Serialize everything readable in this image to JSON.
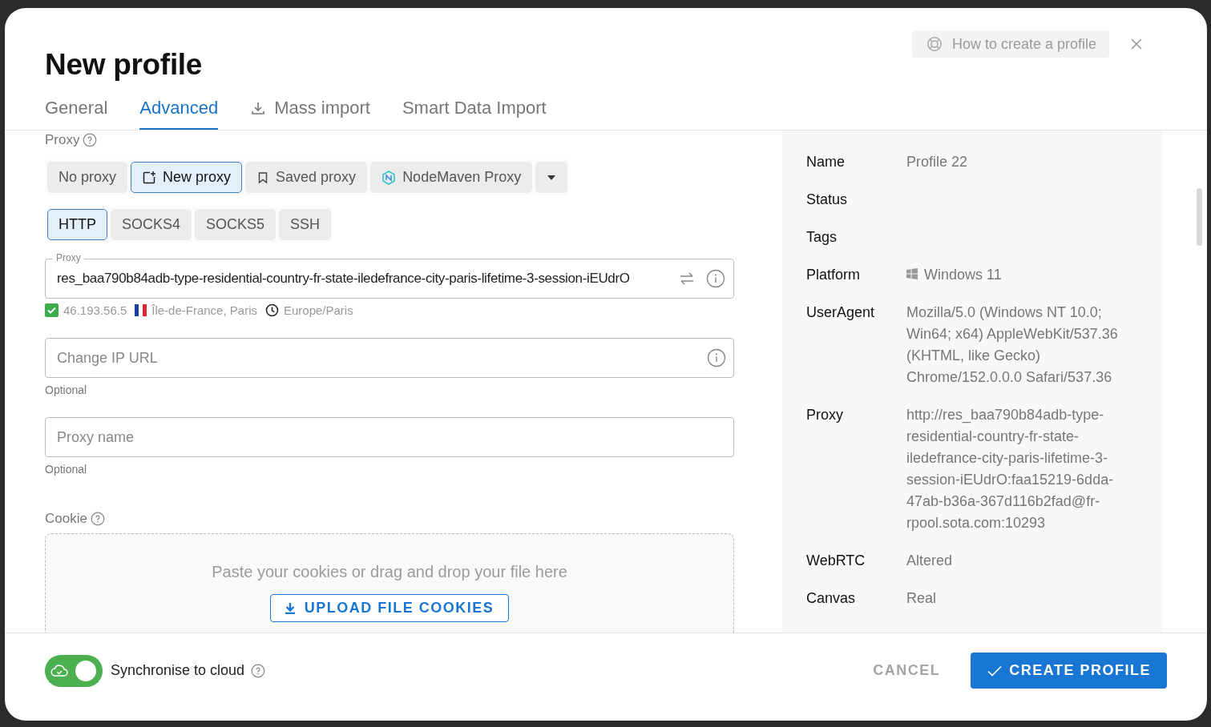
{
  "header": {
    "title": "New profile",
    "help_button": "How to create a profile"
  },
  "tabs": [
    {
      "label": "General",
      "selected": false
    },
    {
      "label": "Advanced",
      "selected": true
    },
    {
      "label": "Mass import",
      "selected": false
    },
    {
      "label": "Smart Data Import",
      "selected": false
    }
  ],
  "proxy_section": {
    "label": "Proxy",
    "sources": [
      {
        "label": "No proxy",
        "selected": false
      },
      {
        "label": "New proxy",
        "selected": true
      },
      {
        "label": "Saved proxy",
        "selected": false
      },
      {
        "label": "NodeMaven Proxy",
        "selected": false
      }
    ],
    "protocols": [
      {
        "label": "HTTP",
        "selected": true
      },
      {
        "label": "SOCKS4",
        "selected": false
      },
      {
        "label": "SOCKS5",
        "selected": false
      },
      {
        "label": "SSH",
        "selected": false
      }
    ],
    "proxy_field": {
      "label": "Proxy",
      "value": "res_baa790b84adb-type-residential-country-fr-state-iledefrance-city-paris-lifetime-3-session-iEUdrO"
    },
    "check": {
      "ok": true,
      "ip": "46.193.56.5",
      "location": "Île-de-France, Paris",
      "timezone": "Europe/Paris"
    },
    "change_ip_field": {
      "placeholder": "Change IP URL",
      "helper": "Optional"
    },
    "name_field": {
      "placeholder": "Proxy name",
      "helper": "Optional"
    }
  },
  "cookie_section": {
    "label": "Cookie",
    "drop_text": "Paste your cookies or drag and drop your file here",
    "upload_button": "UPLOAD FILE COOKIES"
  },
  "summary": [
    {
      "key": "Name",
      "value": "Profile 22"
    },
    {
      "key": "Status"
    },
    {
      "key": "Tags"
    },
    {
      "key": "Platform",
      "value": "Windows 11"
    },
    {
      "key": "UserAgent",
      "value": "Mozilla/5.0 (Windows NT 10.0; Win64; x64) AppleWebKit/537.36 (KHTML, like Gecko) Chrome/152.0.0.0 Safari/537.36"
    },
    {
      "key": "Proxy",
      "value": "http://res_baa790b84adb-type-residential-country-fr-state-iledefrance-city-paris-lifetime-3-session-iEUdrO:faa15219-6dda-47ab-b36a-367d116b2fad@fr-rpool.sota.com:10293"
    },
    {
      "key": "WebRTC",
      "value": "Altered"
    },
    {
      "key": "Canvas",
      "value": "Real"
    }
  ],
  "footer": {
    "sync_label": "Synchronise to cloud",
    "sync_on": true,
    "cancel": "CANCEL",
    "create": "CREATE PROFILE"
  }
}
